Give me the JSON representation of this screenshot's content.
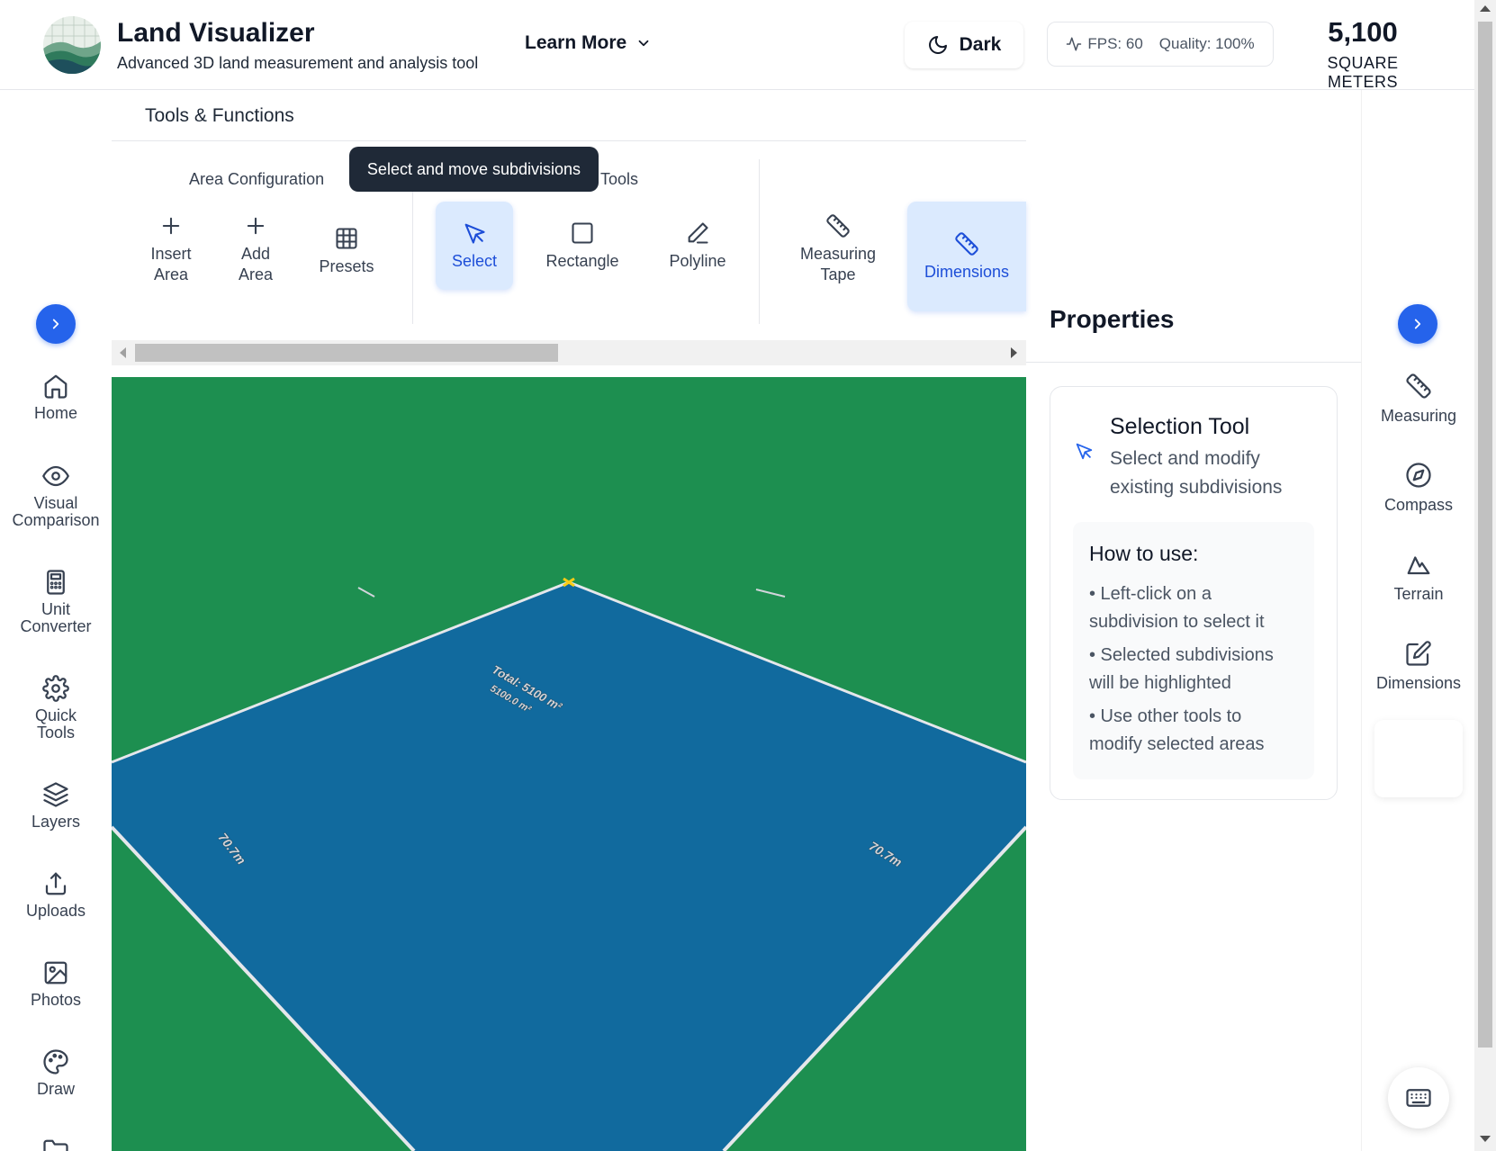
{
  "header": {
    "title": "Land Visualizer",
    "subtitle": "Advanced 3D land measurement and analysis tool",
    "learn_more": "Learn More",
    "theme_toggle": "Dark",
    "fps": "FPS: 60",
    "quality": "Quality: 100%",
    "area_value": "5,100",
    "area_unit": "SQUARE METERS"
  },
  "left_nav": {
    "items": [
      {
        "label": "Home",
        "icon": "home-icon"
      },
      {
        "label": "Visual Comparison",
        "icon": "eye-icon"
      },
      {
        "label": "Unit Converter",
        "icon": "calculator-icon"
      },
      {
        "label": "Quick Tools",
        "icon": "gear-icon"
      },
      {
        "label": "Layers",
        "icon": "layers-icon"
      },
      {
        "label": "Uploads",
        "icon": "upload-icon"
      },
      {
        "label": "Photos",
        "icon": "image-icon"
      },
      {
        "label": "Draw",
        "icon": "palette-icon"
      }
    ]
  },
  "tools": {
    "title": "Tools & Functions",
    "groups": {
      "area_config": "Area Configuration",
      "drawing": "Tools"
    },
    "buttons": {
      "insert_area": "Insert Area",
      "add_area": "Add Area",
      "presets": "Presets",
      "select": "Select",
      "rectangle": "Rectangle",
      "polyline": "Polyline",
      "measuring_tape": "Measuring Tape",
      "dimensions": "Dimensions"
    },
    "tooltip": "Select and move subdivisions"
  },
  "canvas": {
    "colors": {
      "ground": "#1d8f50",
      "plot": "#116a9e",
      "edge": "#e5e7eb"
    },
    "labels": {
      "total": "Total: 5100 m²",
      "sub": "5100.0 m²",
      "left_edge": "70.7m",
      "right_edge": "70.7m"
    }
  },
  "properties": {
    "title": "Properties",
    "tool_name": "Selection Tool",
    "tool_desc": "Select and modify existing subdivisions",
    "howto_title": "How to use:",
    "howto_items": [
      "• Left-click on a subdivision to select it",
      "• Selected subdivisions will be highlighted",
      "• Use other tools to modify selected areas"
    ]
  },
  "right_nav": {
    "items": [
      {
        "label": "Measuring",
        "icon": "ruler-icon"
      },
      {
        "label": "Compass",
        "icon": "compass-icon"
      },
      {
        "label": "Terrain",
        "icon": "mountain-icon"
      },
      {
        "label": "Dimensions",
        "icon": "edit-icon"
      }
    ]
  },
  "accent": "#2563eb"
}
